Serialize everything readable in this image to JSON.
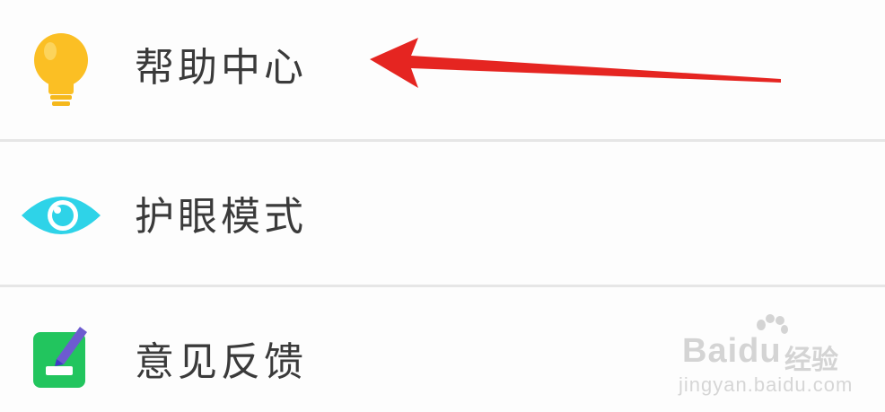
{
  "menu": {
    "items": [
      {
        "label": "帮助中心",
        "icon": "lightbulb-icon",
        "icon_color": "#FBBF24"
      },
      {
        "label": "护眼模式",
        "icon": "eye-icon",
        "icon_color": "#2ED3E8"
      },
      {
        "label": "意见反馈",
        "icon": "feedback-edit-icon",
        "icon_color": "#22C55E"
      }
    ]
  },
  "annotation": {
    "arrow_color": "#E52521",
    "points_to": "帮助中心"
  },
  "watermark": {
    "brand_left": "Bai",
    "brand_right": "du",
    "sub": "经验",
    "url": "jingyan.baidu.com"
  }
}
